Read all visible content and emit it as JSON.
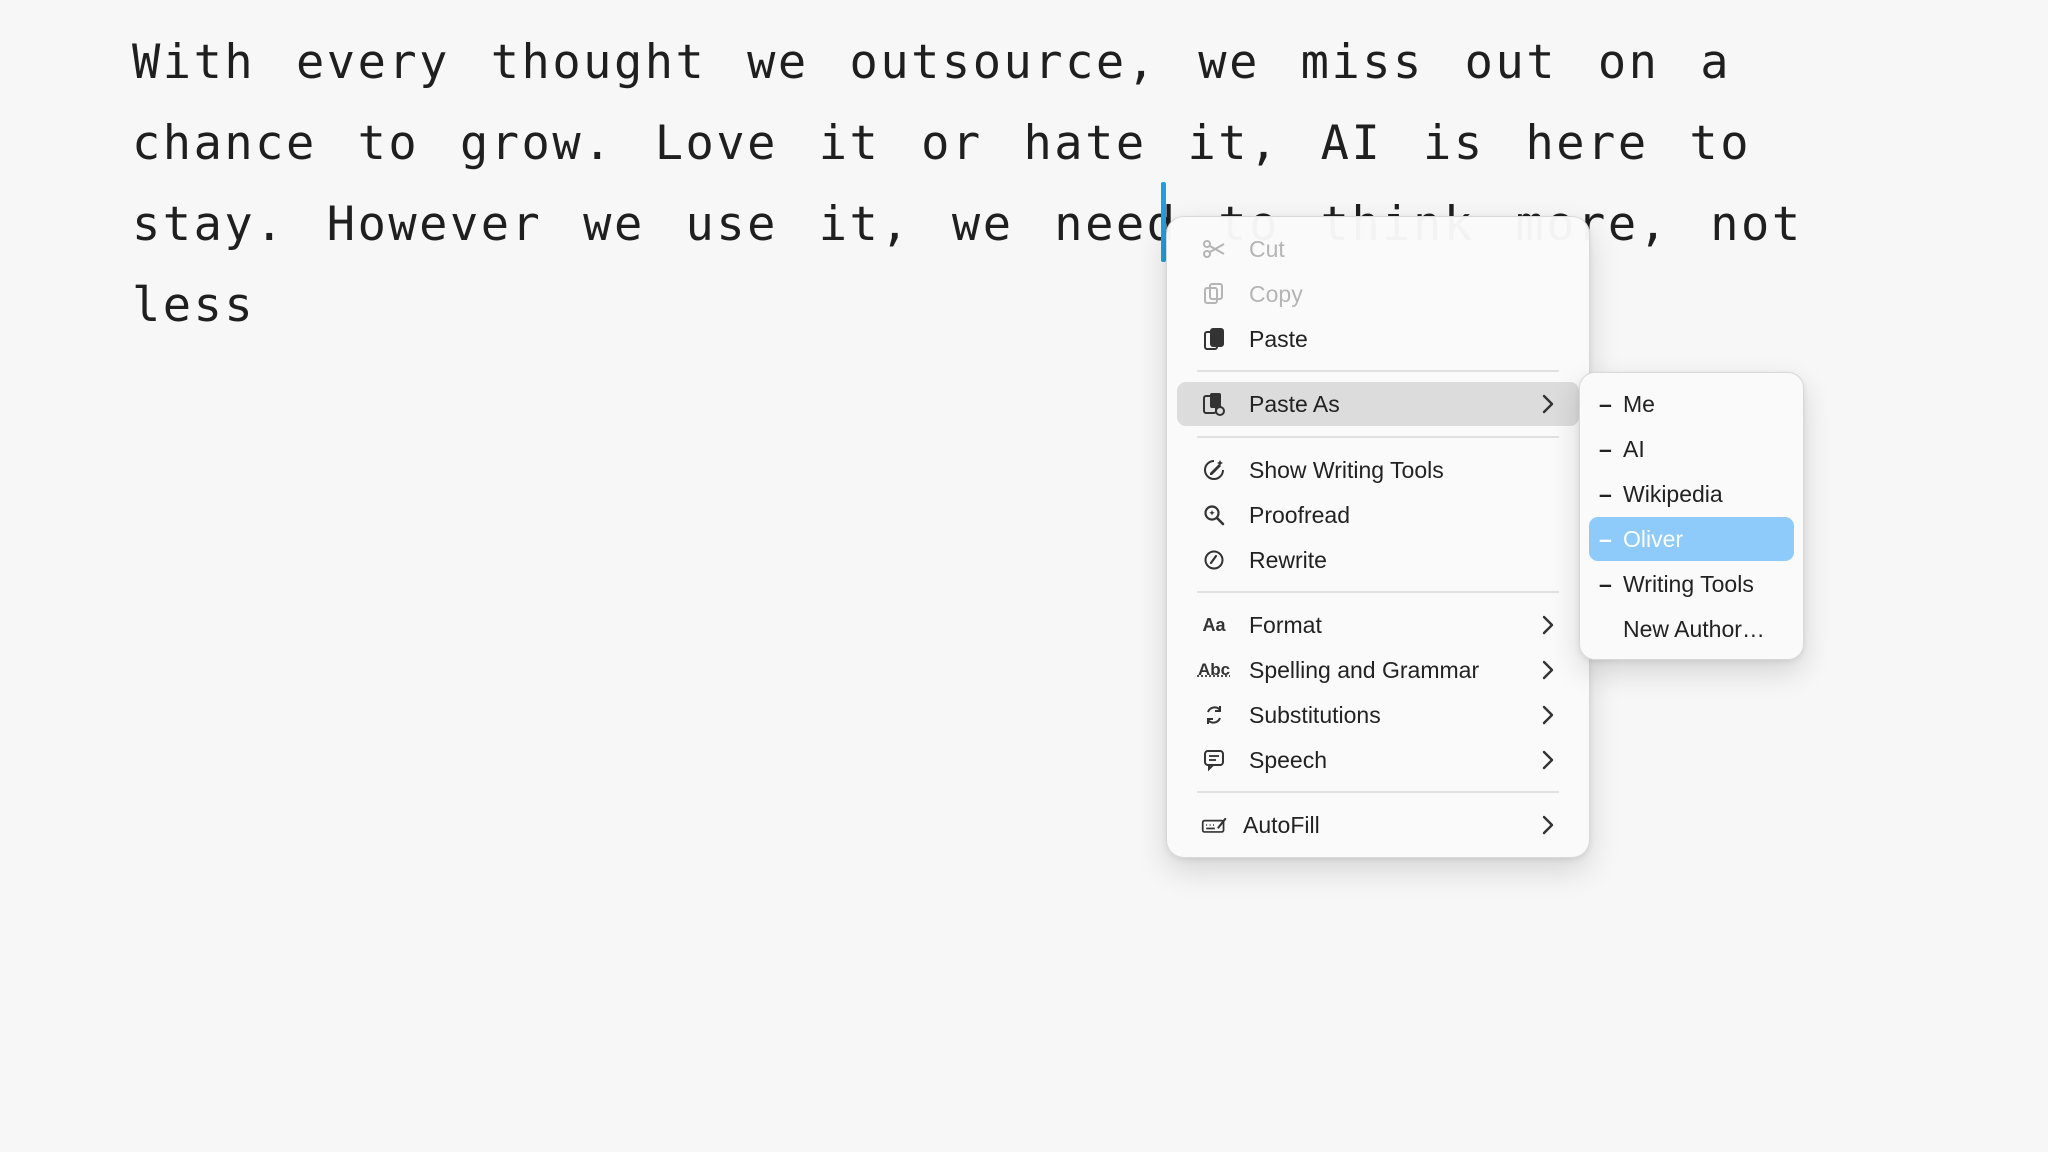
{
  "editor": {
    "text": "With every thought we outsource, we miss out on a chance to grow. Love it or hate it, AI is here to stay. However we use it, we need to think more, not less"
  },
  "context_menu": {
    "items": [
      {
        "label": "Cut",
        "icon": "scissors-icon",
        "enabled": false
      },
      {
        "label": "Copy",
        "icon": "copy-icon",
        "enabled": false
      },
      {
        "label": "Paste",
        "icon": "paste-icon",
        "enabled": true
      },
      {
        "label": "Paste As",
        "icon": "paste-as-icon",
        "enabled": true,
        "submenu": true,
        "highlighted": true
      },
      {
        "label": "Show Writing Tools",
        "icon": "writing-tools-icon",
        "enabled": true
      },
      {
        "label": "Proofread",
        "icon": "proofread-icon",
        "enabled": true
      },
      {
        "label": "Rewrite",
        "icon": "rewrite-icon",
        "enabled": true
      },
      {
        "label": "Format",
        "icon": "format-icon",
        "icon_text": "Aa",
        "enabled": true,
        "submenu": true
      },
      {
        "label": "Spelling and Grammar",
        "icon": "spelling-icon",
        "icon_text": "Abc",
        "enabled": true,
        "submenu": true
      },
      {
        "label": "Substitutions",
        "icon": "substitutions-icon",
        "enabled": true,
        "submenu": true
      },
      {
        "label": "Speech",
        "icon": "speech-icon",
        "enabled": true,
        "submenu": true
      },
      {
        "label": "AutoFill",
        "icon": "autofill-icon",
        "enabled": true,
        "submenu": true
      }
    ]
  },
  "paste_as_submenu": {
    "items": [
      {
        "label": "Me",
        "marker": "–"
      },
      {
        "label": "AI",
        "marker": "–"
      },
      {
        "label": "Wikipedia",
        "marker": "–"
      },
      {
        "label": "Oliver",
        "marker": "–",
        "selected": true
      },
      {
        "label": "Writing Tools",
        "marker": "–"
      },
      {
        "label": "New Author…",
        "marker": ""
      }
    ]
  },
  "colors": {
    "caret": "#1ea0de",
    "selection": "#8ecbfb",
    "menu_highlight": "#dcdcdc"
  }
}
